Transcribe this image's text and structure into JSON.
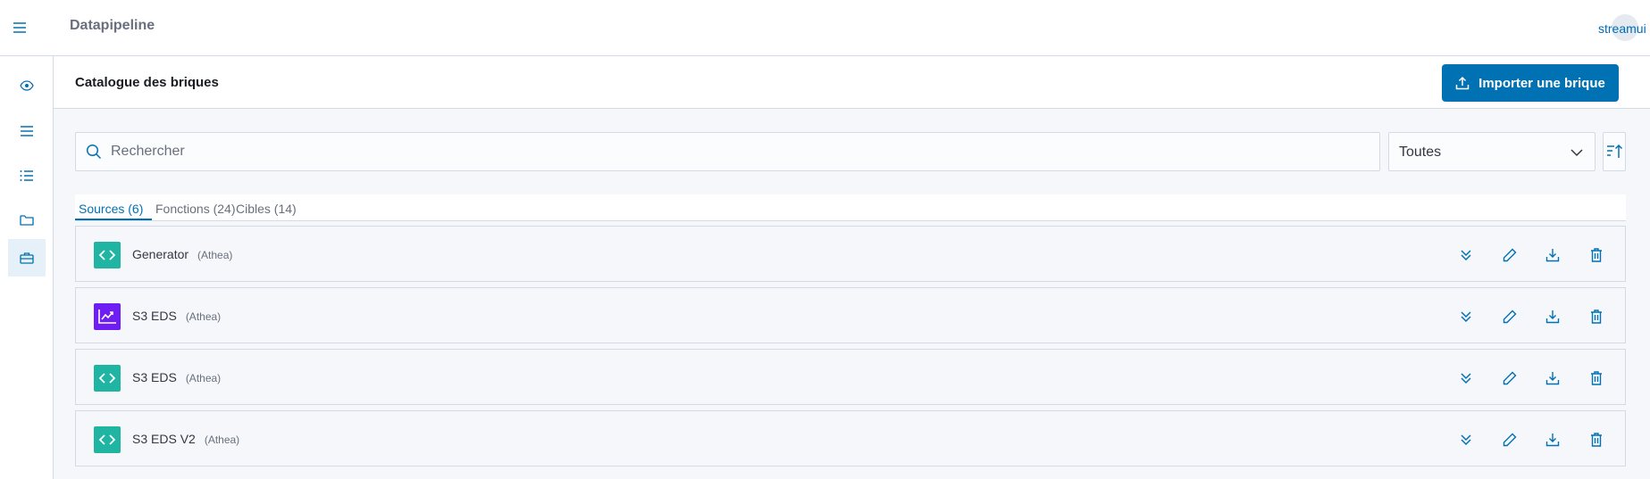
{
  "app": {
    "title": "Datapipeline",
    "user": "streamui"
  },
  "sidebar": {
    "items": [
      {
        "name": "eye-icon"
      },
      {
        "name": "lines-icon"
      },
      {
        "name": "list-icon"
      },
      {
        "name": "folder-icon"
      },
      {
        "name": "bag-icon",
        "active": true
      }
    ]
  },
  "page": {
    "title": "Catalogue des briques",
    "import_label": "Importer une brique"
  },
  "search": {
    "placeholder": "Rechercher",
    "value": ""
  },
  "filter": {
    "selected": "Toutes"
  },
  "tabs": [
    {
      "label": "Sources (6)",
      "active": true
    },
    {
      "label": "Fonctions (24)"
    },
    {
      "label": "Cibles (14)"
    }
  ],
  "bricks": [
    {
      "name": "Generator",
      "owner": "(Athea)",
      "icon": "code-icon"
    },
    {
      "name": "S3 EDS",
      "owner": "(Athea)",
      "icon": "chart-icon"
    },
    {
      "name": "S3 EDS",
      "owner": "(Athea)",
      "icon": "code-icon"
    },
    {
      "name": "S3 EDS V2",
      "owner": "(Athea)",
      "icon": "code-icon"
    }
  ],
  "colors": {
    "accent": "#0071b3",
    "code": "#20b5a2",
    "chart": "#6f1df5"
  }
}
